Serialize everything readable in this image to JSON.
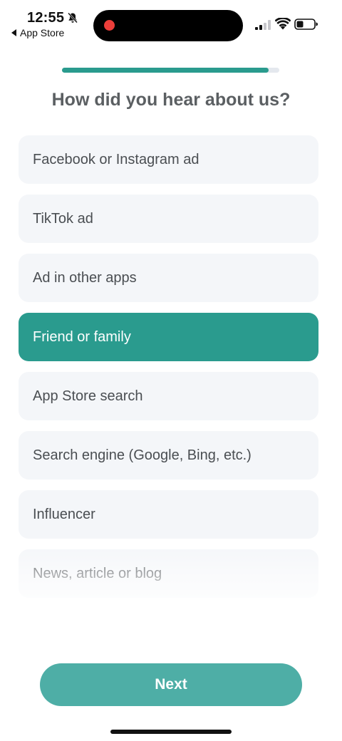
{
  "status_bar": {
    "time": "12:55",
    "back_app": "App Store",
    "icons": [
      "bell-slash-icon",
      "cellular-signal-icon",
      "wifi-icon",
      "battery-icon"
    ]
  },
  "progress": {
    "fraction": 0.95
  },
  "title": "How did you hear about us?",
  "options": [
    {
      "label": "Facebook or Instagram ad",
      "selected": false
    },
    {
      "label": "TikTok ad",
      "selected": false
    },
    {
      "label": "Ad in other apps",
      "selected": false
    },
    {
      "label": "Friend or family",
      "selected": true
    },
    {
      "label": "App Store search",
      "selected": false
    },
    {
      "label": "Search engine (Google, Bing, etc.)",
      "selected": false
    },
    {
      "label": "Influencer",
      "selected": false
    },
    {
      "label": "News, article or blog",
      "selected": false
    }
  ],
  "next_button": {
    "label": "Next"
  },
  "colors": {
    "accent": "#2a9b8e",
    "button": "#4eaea6",
    "option_bg": "#f4f6f9"
  }
}
